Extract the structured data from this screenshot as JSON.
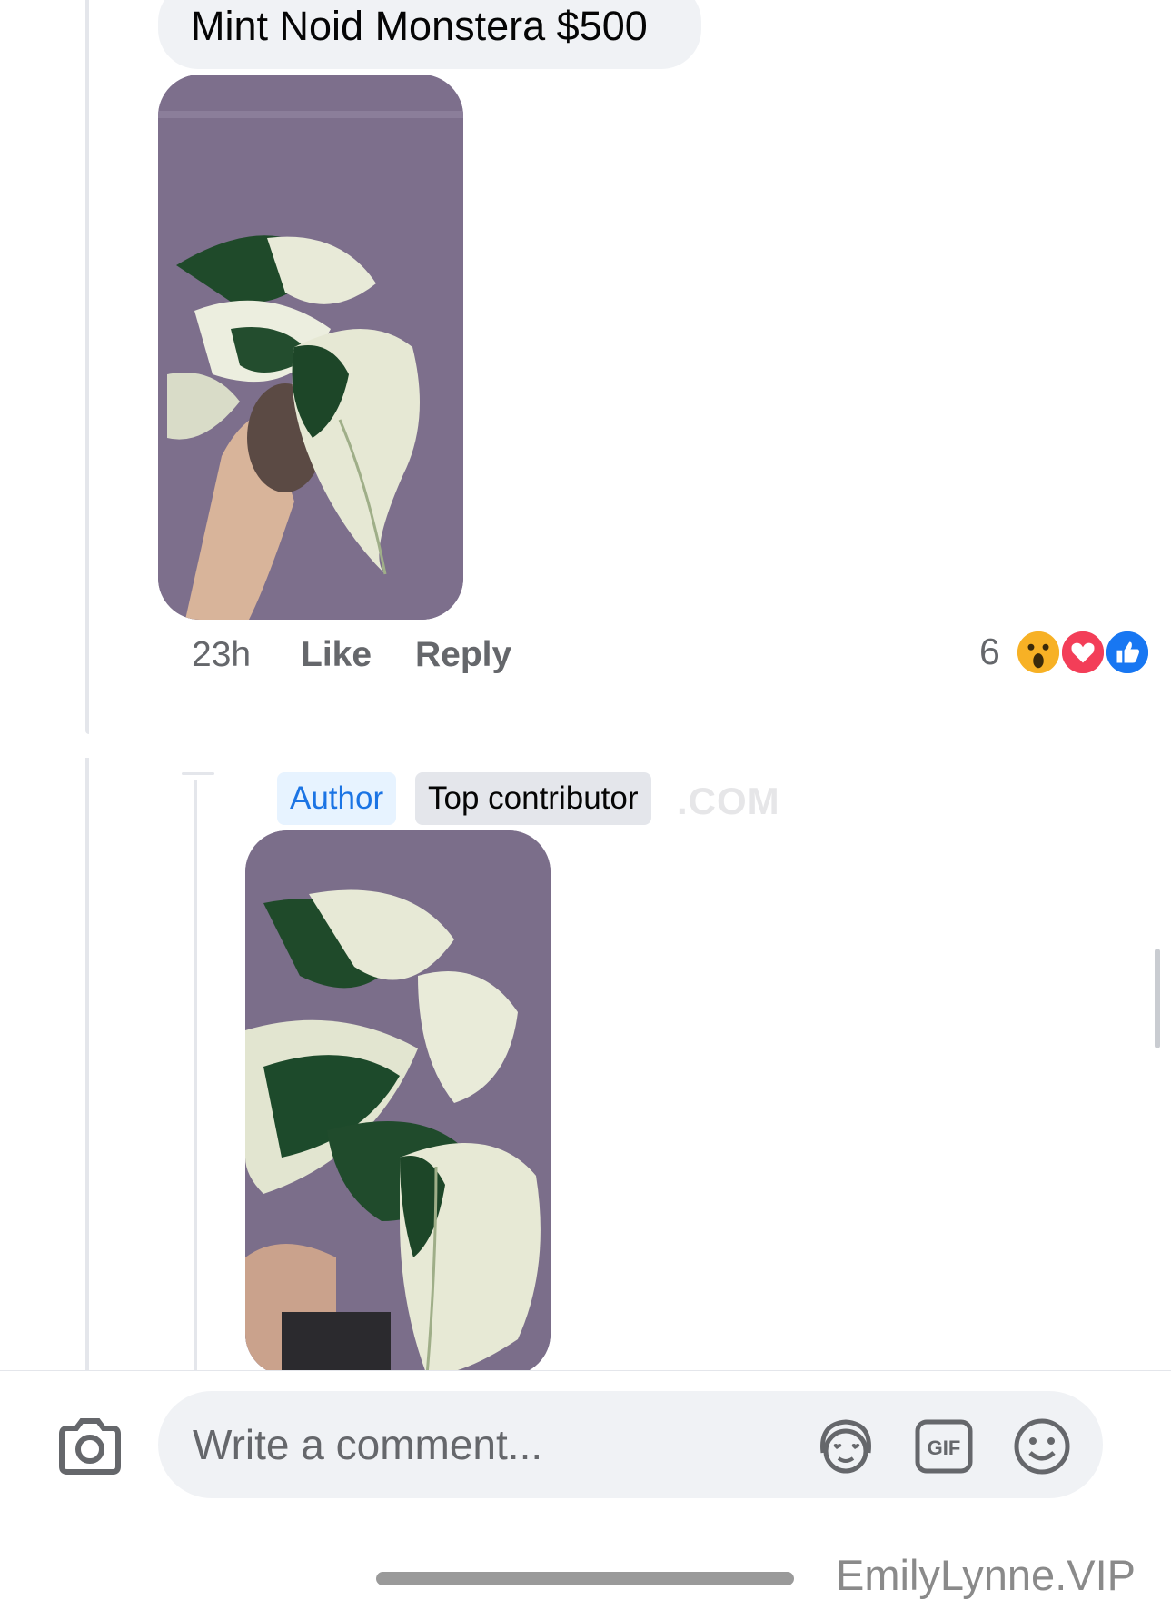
{
  "comment": {
    "text": "Mint Noid Monstera $500",
    "time": "23h",
    "like_label": "Like",
    "reply_label": "Reply",
    "reaction_count": "6",
    "reactions": [
      "wow",
      "love",
      "like"
    ]
  },
  "reply": {
    "badges": {
      "author": "Author",
      "top_contributor": "Top contributor"
    },
    "faint_watermark": ".COM"
  },
  "composer": {
    "placeholder": "Write a comment...",
    "icons": [
      "camera-icon",
      "avatar-sticker-icon",
      "gif-icon",
      "emoji-icon"
    ],
    "gif_label": "GIF"
  },
  "watermark": "EmilyLynne.VIP",
  "colors": {
    "bubble": "#f0f2f5",
    "secondary_text": "#65676b",
    "author_badge_text": "#1b74e4",
    "author_badge_bg": "#e7f3ff",
    "wow": "#f7b125",
    "love": "#f33e58",
    "like": "#1877f2"
  }
}
